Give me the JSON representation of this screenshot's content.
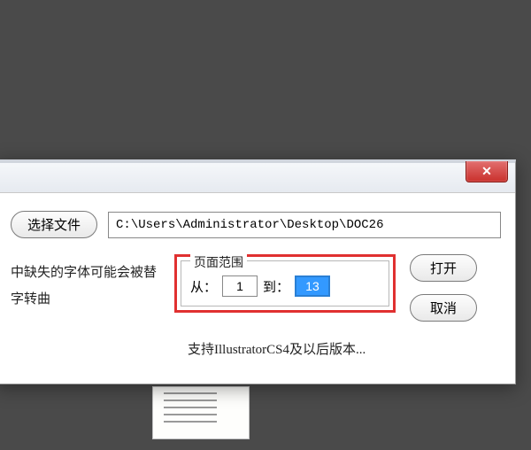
{
  "buttons": {
    "choose_file": "选择文件",
    "open": "打开",
    "cancel": "取消"
  },
  "file_path": "C:\\Users\\Administrator\\Desktop\\DOC26",
  "hint_text_line1": "中缺失的字体可能会被替",
  "hint_text_line2": "字转曲",
  "range": {
    "legend": "页面范围",
    "from_label": "从：",
    "from_value": "1",
    "to_label": "到：",
    "to_value": "13"
  },
  "footer": "支持IllustratorCS4及以后版本...",
  "close_glyph": "✕"
}
